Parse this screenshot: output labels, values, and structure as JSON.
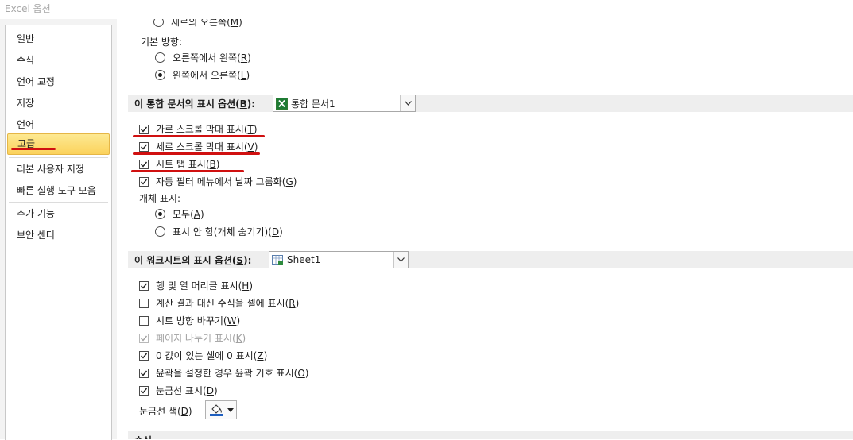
{
  "window": {
    "title": "Excel 옵션"
  },
  "sidebar": {
    "items": [
      {
        "label": "일반"
      },
      {
        "label": "수식"
      },
      {
        "label": "언어 교정"
      },
      {
        "label": "저장"
      },
      {
        "label": "언어"
      },
      {
        "label": "고급",
        "selected": true
      },
      {
        "label": "리본 사용자 지정"
      },
      {
        "label": "빠른 실행 도구 모음"
      },
      {
        "label": "추가 기능"
      },
      {
        "label": "보안 센터"
      }
    ]
  },
  "top": {
    "partial_option": {
      "label": "세로의 오른쪽",
      "key": "M"
    },
    "default_direction_label": "기본 방향:",
    "rtl": {
      "label": "오른쪽에서 왼쪽",
      "key": "R",
      "selected": false
    },
    "ltr": {
      "label": "왼쪽에서 오른쪽",
      "key": "L",
      "selected": true
    }
  },
  "workbook_section": {
    "title": "이 통합 문서의 표시 옵션(",
    "key": "B",
    "title_suffix": "):",
    "combo_value": "통합 문서1",
    "options": [
      {
        "label": "가로 스크롤 막대 표시",
        "key": "T",
        "checked": true
      },
      {
        "label": "세로 스크롤 막대 표시",
        "key": "V",
        "checked": true
      },
      {
        "label": "시트 탭 표시",
        "key": "B",
        "checked": true
      },
      {
        "label": "자동 필터 메뉴에서 날짜 그룹화",
        "key": "G",
        "checked": true
      }
    ],
    "objects_label": "개체 표시:",
    "object_options": [
      {
        "label": "모두",
        "key": "A",
        "selected": true
      },
      {
        "label": "표시 안 함(개체 숨기기)",
        "key": "D",
        "selected": false
      }
    ]
  },
  "worksheet_section": {
    "title": "이 워크시트의 표시 옵션(",
    "key": "S",
    "title_suffix": "):",
    "combo_value": "Sheet1",
    "options": [
      {
        "label": "행 및 열 머리글 표시",
        "key": "H",
        "checked": true,
        "disabled": false
      },
      {
        "label": "계산 결과 대신 수식을 셀에 표시",
        "key": "R",
        "checked": false,
        "disabled": false
      },
      {
        "label": "시트 방향 바꾸기",
        "key": "W",
        "checked": false,
        "disabled": false
      },
      {
        "label": "페이지 나누기 표시",
        "key": "K",
        "checked": true,
        "disabled": true
      },
      {
        "label": "0 값이 있는 셀에 0 표시",
        "key": "Z",
        "checked": true,
        "disabled": false
      },
      {
        "label": "윤곽을 설정한 경우 윤곽 기호 표시",
        "key": "O",
        "checked": true,
        "disabled": false
      },
      {
        "label": "눈금선 표시",
        "key": "D",
        "checked": true,
        "disabled": false
      }
    ],
    "gridline_color_label": "눈금선 색",
    "gridline_color_key": "D",
    "gridline_color": "#1f5fbf"
  },
  "next_section": {
    "title": "수식"
  },
  "annotation_color": "#d01010"
}
